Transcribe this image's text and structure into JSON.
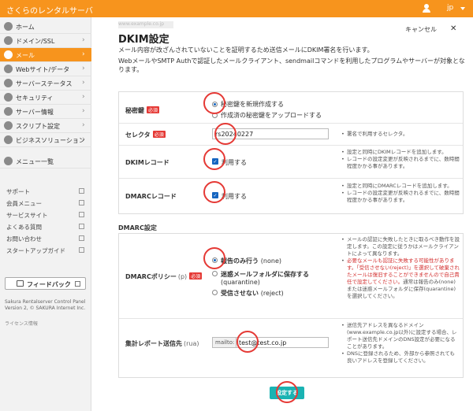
{
  "header": {
    "brand": "さくらのレンタルサーバ",
    "user_icon": "user-icon",
    "lang": "jp"
  },
  "sidebar": {
    "items": [
      {
        "label": "ホーム",
        "chevron": false,
        "active": false
      },
      {
        "label": "ドメイン/SSL",
        "chevron": true,
        "active": false
      },
      {
        "label": "メール",
        "chevron": true,
        "active": true
      },
      {
        "label": "Webサイト/データ",
        "chevron": true,
        "active": false
      },
      {
        "label": "サーバーステータス",
        "chevron": true,
        "active": false
      },
      {
        "label": "セキュリティ",
        "chevron": true,
        "active": false
      },
      {
        "label": "サーバー情報",
        "chevron": true,
        "active": false
      },
      {
        "label": "スクリプト設定",
        "chevron": true,
        "active": false
      },
      {
        "label": "ビジネスソリューション",
        "chevron": true,
        "active": false
      },
      {
        "label": "メニュー一覧",
        "chevron": false,
        "active": false
      }
    ],
    "links": [
      "サポート",
      "会員メニュー",
      "サービスサイト",
      "よくある質問",
      "お問い合わせ",
      "スタートアップガイド"
    ],
    "feedback_label": "フィードバック",
    "copyright": [
      "Sakura Rentalserver Control Panel",
      "Version 2, © SAKURA Internet Inc."
    ],
    "license": "ライセンス情報"
  },
  "main": {
    "breadcrumb": "www.example.co.jp",
    "title": "DKIM設定",
    "cancel": "キャンセル",
    "description": [
      "メール内容が改ざんされていないことを証明するため送信メールにDKIM署名を行います。",
      "WebメールやSMTP Authで認証したメールクライアント、sendmailコマンドを利用したプログラムやサーバーが対象となります。"
    ],
    "required_badge": "必須",
    "secret_key": {
      "label": "秘密鍵",
      "options": [
        "秘密鍵を新規作成する",
        "作成済の秘密鍵をアップロードする"
      ],
      "selected": 0
    },
    "selector": {
      "label": "セレクタ",
      "value": "rs20240227",
      "hint": "署名で利用するセレクタ。"
    },
    "dkim_record": {
      "label": "DKIMレコード",
      "checkbox": "利用する",
      "checked": true,
      "hints": [
        "設定と同時にDKIMレコードを追加します。",
        "レコードの設定変更が反映されるまでに、数時間程度かかる事があります。"
      ]
    },
    "dmarc_record": {
      "label": "DMARCレコード",
      "checkbox": "利用する",
      "checked": true,
      "hints": [
        "設定と同時にDMARCレコードを追加します。",
        "レコードの設定変更が反映されるまでに、数時間程度かかる事があります。"
      ]
    },
    "dmarc_section_title": "DMARC設定",
    "dmarc_policy": {
      "label": "DMARCポリシー",
      "param": "(p)",
      "options": [
        {
          "main": "報告のみ行う",
          "sub": "(none)"
        },
        {
          "main": "迷惑メールフォルダに保存する",
          "sub": "(quarantine)"
        },
        {
          "main": "受信させない",
          "sub": "(reject)"
        }
      ],
      "selected": 0,
      "hint_normal_1": "メールの認証に失敗したときに取るべき動作を設定します。この設定に従うかはメールクライアントによって異なります。",
      "hint_warn": "必要なメールも認証に失敗する可能性があります。「受信させない(reject)」を選択して破棄されたメールは復旧することができませんので自己責任で設定してください。",
      "hint_normal_2": "通常は報告のみ(none)または迷惑メールフォルダに保存(quarantine)を選択してください。"
    },
    "report_dest": {
      "label": "集計レポート送信先",
      "param": "(rua)",
      "prefix": "mailto:",
      "value": "test@test.co.jp",
      "hints": [
        "送信先アドレスを異なるドメイン(www.example.co.jp以外)に設定する場合、レポート送信先ドメインのDNS設定が必要になることがあります。",
        "DNSに登録されるため、外部から参照されても良いアドレスを登録してください。"
      ]
    },
    "submit": "設定する"
  },
  "colors": {
    "brand": "#f7941d",
    "submit": "#1ab3b3",
    "required": "#e53935",
    "annotation": "#e53935"
  }
}
